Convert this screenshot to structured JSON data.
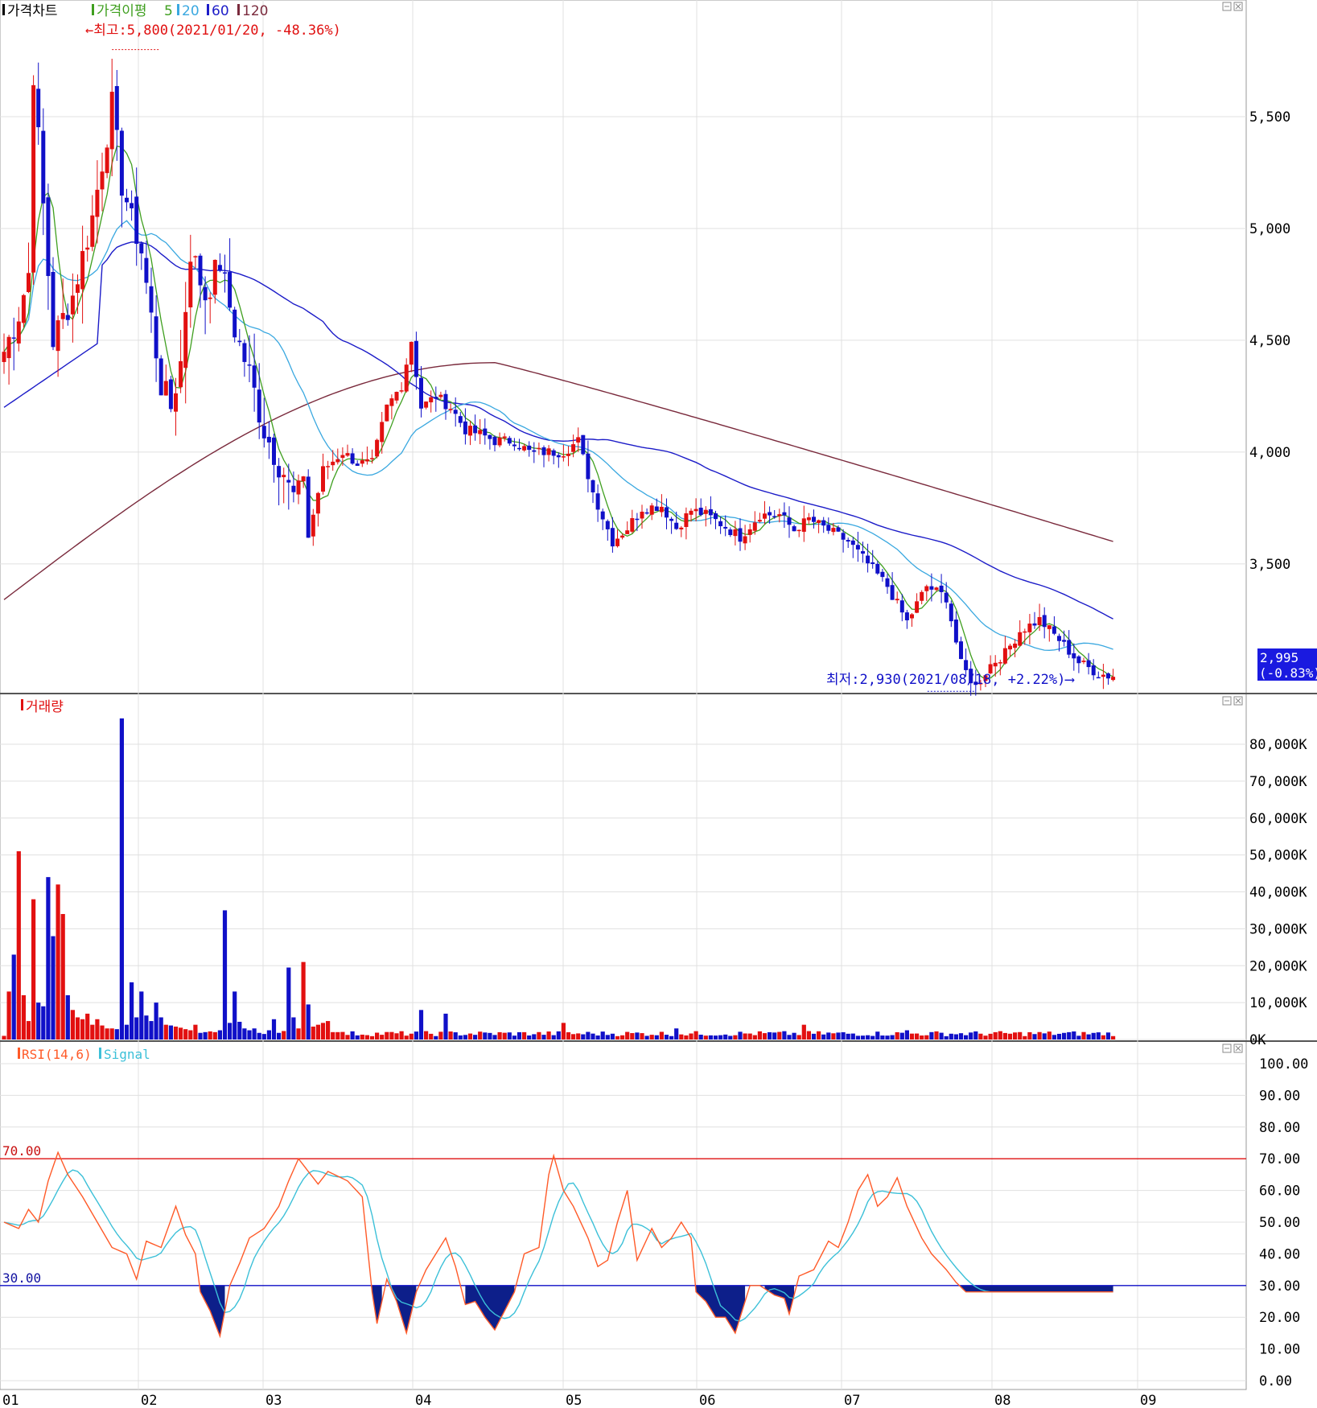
{
  "colors": {
    "up": "#e21010",
    "down": "#1010c8",
    "ma5": "#3f9f1f",
    "ma20": "#3aa8e0",
    "ma60": "#1c1cc8",
    "ma120": "#7a2a3c",
    "rsi": "#ff5a28",
    "signal": "#3cc0d8",
    "fill": "#0d1f8a",
    "grid": "#e0e0e0",
    "hi_line": "#e01010",
    "lo_line": "#1010c8"
  },
  "price_panel": {
    "legend": [
      {
        "text": "가격차트",
        "color": "#000000"
      },
      {
        "text": "가격이평",
        "color": "#3f9f1f"
      },
      {
        "text": "5",
        "color": "#3f9f1f"
      },
      {
        "text": "20",
        "color": "#3aa8e0"
      },
      {
        "text": "60",
        "color": "#1c1cc8"
      },
      {
        "text": "120",
        "color": "#7a2a3c"
      }
    ],
    "high_annotation": "←최고:5,800(2021/01/20, -48.36%)",
    "low_annotation": "최저:2,930(2021/08/18, +2.22%)⟶",
    "current_price": "2,995",
    "current_change": "(-0.83%)",
    "y_ticks": [
      "5,500",
      "5,000",
      "4,500",
      "4,000",
      "3,500"
    ],
    "y_tick_values": [
      5500,
      5000,
      4500,
      4000,
      3500
    ]
  },
  "volume_panel": {
    "legend": "거래량",
    "y_ticks": [
      "80,000K",
      "70,000K",
      "60,000K",
      "50,000K",
      "40,000K",
      "30,000K",
      "20,000K",
      "10,000K",
      "0K"
    ],
    "y_tick_values": [
      80000,
      70000,
      60000,
      50000,
      40000,
      30000,
      20000,
      10000,
      0
    ]
  },
  "rsi_panel": {
    "legend_rsi": "RSI(14,6)",
    "legend_signal": "Signal",
    "upper_level_label": "70.00",
    "lower_level_label": "30.00",
    "y_ticks": [
      "100.00",
      "90.00",
      "80.00",
      "70.00",
      "60.00",
      "50.00",
      "40.00",
      "30.00",
      "20.00",
      "10.00",
      "0.00"
    ],
    "y_tick_values": [
      100,
      90,
      80,
      70,
      60,
      50,
      40,
      30,
      20,
      10,
      0
    ]
  },
  "x_axis": {
    "labels": [
      "01",
      "02",
      "03",
      "04",
      "05",
      "06",
      "07",
      "08",
      "09"
    ]
  },
  "chart_data": [
    {
      "type": "candlestick",
      "title": "",
      "ylim": [
        2920,
        5950
      ],
      "reference_lines": {
        "high": 5800,
        "low": 2930
      },
      "series_names": [
        "가격차트",
        "5",
        "20",
        "60",
        "120"
      ],
      "anchors_close": [
        [
          0,
          4450
        ],
        [
          3,
          4620
        ],
        [
          5,
          4800
        ],
        [
          6,
          5700
        ],
        [
          8,
          5100
        ],
        [
          10,
          4500
        ],
        [
          14,
          4700
        ],
        [
          18,
          5050
        ],
        [
          20,
          5300
        ],
        [
          22,
          5550
        ],
        [
          24,
          5200
        ],
        [
          28,
          4900
        ],
        [
          32,
          4300
        ],
        [
          34,
          4200
        ],
        [
          36,
          4400
        ],
        [
          38,
          4900
        ],
        [
          41,
          4700
        ],
        [
          44,
          4850
        ],
        [
          47,
          4550
        ],
        [
          50,
          4350
        ],
        [
          53,
          4100
        ],
        [
          56,
          3950
        ],
        [
          59,
          3800
        ],
        [
          61,
          3900
        ],
        [
          62,
          3620
        ],
        [
          65,
          3920
        ],
        [
          69,
          4000
        ],
        [
          72,
          3950
        ],
        [
          75,
          3950
        ],
        [
          78,
          4200
        ],
        [
          81,
          4300
        ],
        [
          83,
          4500
        ],
        [
          85,
          4200
        ],
        [
          88,
          4250
        ],
        [
          91,
          4200
        ],
        [
          94,
          4100
        ],
        [
          97,
          4080
        ],
        [
          100,
          4050
        ],
        [
          104,
          4050
        ],
        [
          107,
          4000
        ],
        [
          111,
          4000
        ],
        [
          114,
          4000
        ],
        [
          117,
          4050
        ],
        [
          120,
          3820
        ],
        [
          124,
          3600
        ],
        [
          127,
          3660
        ],
        [
          130,
          3750
        ],
        [
          134,
          3760
        ],
        [
          137,
          3660
        ],
        [
          140,
          3740
        ],
        [
          143,
          3720
        ],
        [
          146,
          3680
        ],
        [
          150,
          3620
        ],
        [
          154,
          3720
        ],
        [
          158,
          3720
        ],
        [
          161,
          3650
        ],
        [
          164,
          3700
        ],
        [
          168,
          3650
        ],
        [
          172,
          3600
        ],
        [
          176,
          3500
        ],
        [
          180,
          3400
        ],
        [
          184,
          3240
        ],
        [
          188,
          3400
        ],
        [
          192,
          3350
        ],
        [
          195,
          3050
        ],
        [
          198,
          2950
        ],
        [
          201,
          3050
        ],
        [
          204,
          3100
        ],
        [
          207,
          3200
        ],
        [
          211,
          3250
        ],
        [
          215,
          3160
        ],
        [
          219,
          3060
        ],
        [
          223,
          3010
        ],
        [
          226,
          2995
        ]
      ],
      "volume_spikes_k": [
        [
          1,
          13000
        ],
        [
          2,
          23000
        ],
        [
          3,
          51000
        ],
        [
          4,
          12000
        ],
        [
          5,
          5000
        ],
        [
          6,
          38000
        ],
        [
          7,
          10000
        ],
        [
          8,
          9000
        ],
        [
          9,
          44000
        ],
        [
          10,
          28000
        ],
        [
          11,
          42000
        ],
        [
          12,
          34000
        ],
        [
          13,
          12000
        ],
        [
          14,
          8000
        ],
        [
          15,
          6000
        ],
        [
          16,
          5500
        ],
        [
          17,
          7000
        ],
        [
          18,
          4000
        ],
        [
          19,
          5500
        ],
        [
          20,
          3800
        ],
        [
          21,
          3000
        ],
        [
          22,
          3000
        ],
        [
          23,
          2800
        ],
        [
          24,
          87000
        ],
        [
          25,
          4000
        ],
        [
          26,
          15500
        ],
        [
          27,
          6000
        ],
        [
          28,
          13000
        ],
        [
          29,
          6500
        ],
        [
          30,
          5000
        ],
        [
          31,
          10000
        ],
        [
          32,
          6000
        ],
        [
          33,
          4000
        ],
        [
          34,
          3800
        ],
        [
          35,
          3500
        ],
        [
          36,
          3200
        ],
        [
          37,
          2800
        ],
        [
          38,
          2500
        ],
        [
          39,
          4000
        ],
        [
          40,
          1800
        ],
        [
          41,
          2000
        ],
        [
          42,
          2200
        ],
        [
          43,
          2000
        ],
        [
          44,
          2500
        ],
        [
          45,
          35000
        ],
        [
          46,
          4500
        ],
        [
          47,
          13000
        ],
        [
          48,
          4800
        ],
        [
          49,
          3000
        ],
        [
          50,
          2500
        ],
        [
          51,
          3000
        ],
        [
          52,
          1800
        ],
        [
          53,
          1500
        ],
        [
          54,
          2500
        ],
        [
          55,
          5500
        ],
        [
          56,
          1800
        ],
        [
          57,
          2300
        ],
        [
          58,
          19500
        ],
        [
          59,
          6000
        ],
        [
          60,
          3000
        ],
        [
          61,
          21000
        ],
        [
          62,
          9500
        ],
        [
          63,
          3500
        ],
        [
          64,
          4000
        ],
        [
          65,
          4500
        ],
        [
          66,
          5000
        ],
        [
          67,
          2000
        ],
        [
          68,
          2000
        ],
        [
          85,
          8000
        ],
        [
          90,
          7000
        ],
        [
          114,
          4500
        ],
        [
          137,
          3000
        ],
        [
          163,
          4000
        ],
        [
          184,
          2500
        ]
      ],
      "rsi_anchors": [
        [
          0,
          50
        ],
        [
          3,
          48
        ],
        [
          5,
          54
        ],
        [
          7,
          50
        ],
        [
          9,
          63
        ],
        [
          11,
          72
        ],
        [
          13,
          65
        ],
        [
          16,
          58
        ],
        [
          19,
          50
        ],
        [
          22,
          42
        ],
        [
          25,
          40
        ],
        [
          27,
          32
        ],
        [
          29,
          44
        ],
        [
          32,
          42
        ],
        [
          35,
          55
        ],
        [
          37,
          46
        ],
        [
          39,
          40
        ],
        [
          40,
          28
        ],
        [
          42,
          22
        ],
        [
          44,
          14
        ],
        [
          46,
          30
        ],
        [
          48,
          37
        ],
        [
          50,
          45
        ],
        [
          53,
          48
        ],
        [
          56,
          55
        ],
        [
          58,
          63
        ],
        [
          60,
          70
        ],
        [
          62,
          66
        ],
        [
          64,
          62
        ],
        [
          66,
          66
        ],
        [
          70,
          63
        ],
        [
          73,
          58
        ],
        [
          75,
          28
        ],
        [
          76,
          18
        ],
        [
          78,
          32
        ],
        [
          80,
          25
        ],
        [
          82,
          15
        ],
        [
          84,
          28
        ],
        [
          86,
          35
        ],
        [
          88,
          40
        ],
        [
          90,
          45
        ],
        [
          92,
          36
        ],
        [
          94,
          24
        ],
        [
          96,
          25
        ],
        [
          98,
          20
        ],
        [
          100,
          16
        ],
        [
          102,
          22
        ],
        [
          104,
          28
        ],
        [
          106,
          40
        ],
        [
          109,
          42
        ],
        [
          111,
          65
        ],
        [
          112,
          71
        ],
        [
          114,
          60
        ],
        [
          116,
          55
        ],
        [
          119,
          45
        ],
        [
          121,
          36
        ],
        [
          123,
          38
        ],
        [
          125,
          50
        ],
        [
          127,
          60
        ],
        [
          129,
          38
        ],
        [
          132,
          48
        ],
        [
          134,
          42
        ],
        [
          136,
          45
        ],
        [
          138,
          50
        ],
        [
          140,
          45
        ],
        [
          141,
          28
        ],
        [
          143,
          25
        ],
        [
          145,
          20
        ],
        [
          147,
          20
        ],
        [
          149,
          15
        ],
        [
          150,
          20
        ],
        [
          152,
          30
        ],
        [
          154,
          30
        ],
        [
          157,
          27
        ],
        [
          159,
          26
        ],
        [
          160,
          21
        ],
        [
          162,
          33
        ],
        [
          165,
          35
        ],
        [
          168,
          44
        ],
        [
          170,
          42
        ],
        [
          172,
          50
        ],
        [
          174,
          60
        ],
        [
          176,
          65
        ],
        [
          178,
          55
        ],
        [
          180,
          58
        ],
        [
          182,
          64
        ],
        [
          184,
          55
        ],
        [
          187,
          45
        ],
        [
          189,
          40
        ],
        [
          192,
          35
        ],
        [
          194,
          31
        ],
        [
          196,
          28
        ]
      ]
    }
  ]
}
